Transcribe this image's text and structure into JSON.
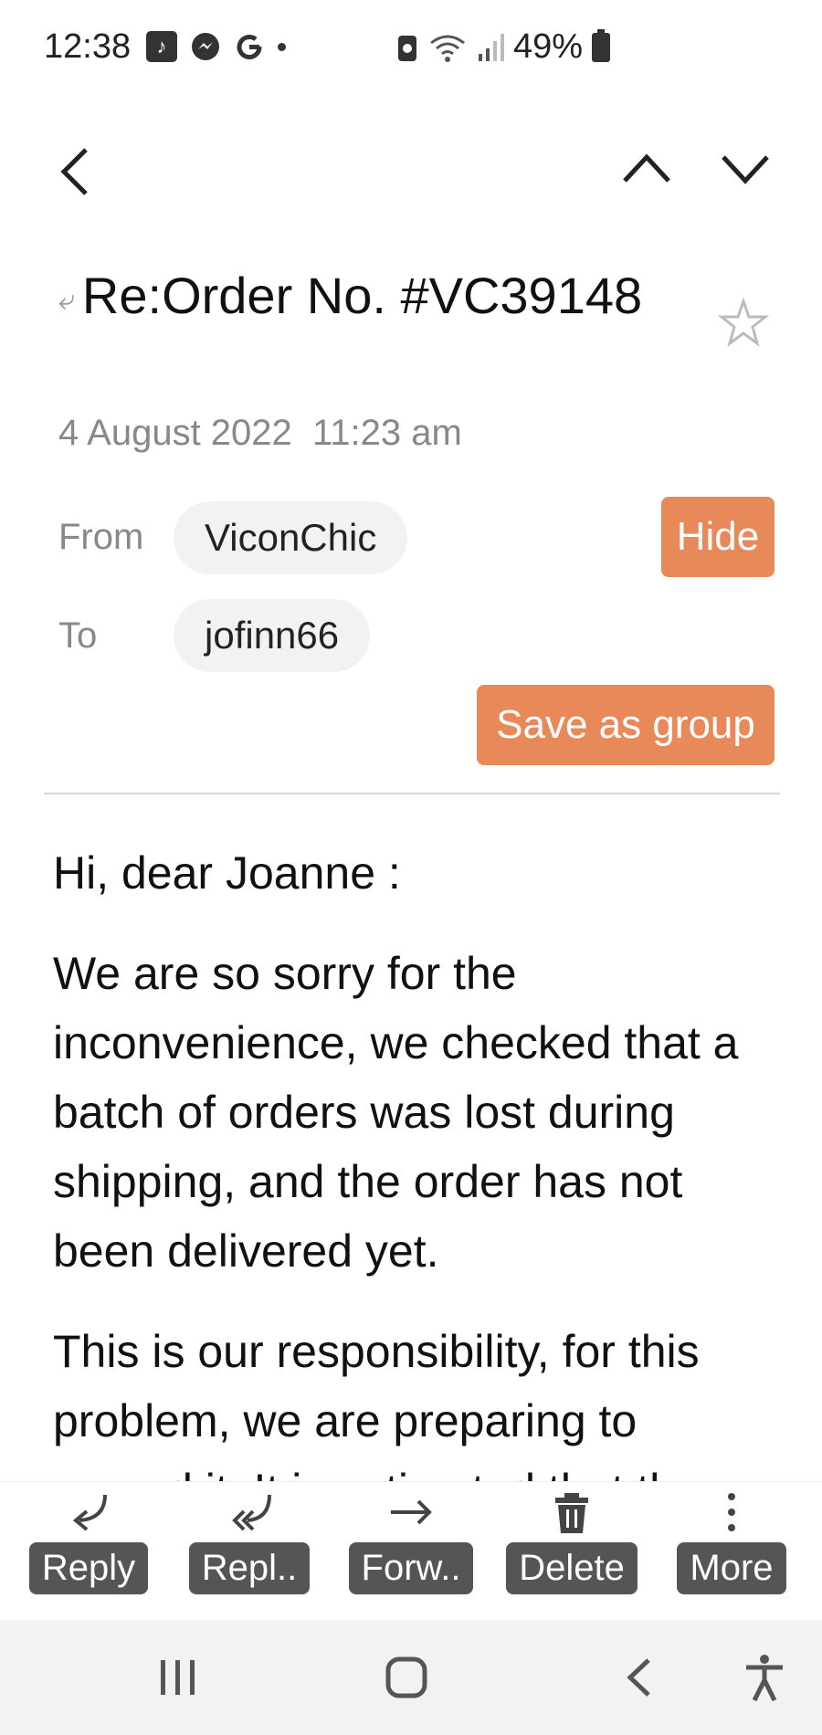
{
  "status_bar": {
    "time": "12:38",
    "app_icons": [
      "music-app-icon",
      "messenger-icon",
      "google-icon"
    ],
    "battery": "49%"
  },
  "email": {
    "subject": "Re:Order No. #VC39148",
    "date": "4 August 2022",
    "time": "11:23 am",
    "from_label": "From",
    "from": "ViconChic",
    "to_label": "To",
    "to": "jofinn66",
    "hide_label": "Hide",
    "save_group_label": "Save as group",
    "greeting": "Hi, dear Joanne :",
    "paragraph1": "We are so sorry for the inconvenience, we checked that a batch of orders was lost during shipping, and the order has not been delivered yet.",
    "paragraph2": "This is our responsibility, for this problem, we are preparing to resend it. It is estimated that the"
  },
  "toolbar": {
    "reply": "Reply",
    "reply_all": "Repl..",
    "forward": "Forw..",
    "delete": "Delete",
    "more": "More"
  },
  "colors": {
    "accent": "#e8895a",
    "toolbar_label_bg": "#555555"
  }
}
